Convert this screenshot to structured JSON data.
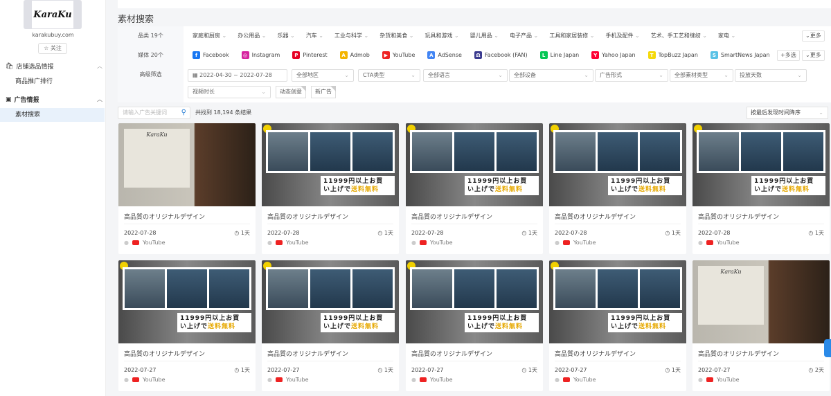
{
  "sidebar": {
    "logo_text": "KaraKu",
    "domain": "karakubuy.com",
    "follow": "☆ 关注",
    "sections": [
      {
        "label": "店铺选品情报",
        "items": [
          "商品推广排行"
        ]
      },
      {
        "label": "广告情报",
        "items": [
          "素材搜索"
        ]
      }
    ]
  },
  "page_title": "素材搜索",
  "filters": {
    "category_label": "品类 19个",
    "categories": [
      "家庭和厨房",
      "办公用品",
      "乐器",
      "汽车",
      "工业与科学",
      "杂货和美食",
      "玩具和游戏",
      "婴儿用品",
      "电子产品",
      "工具和家居装修",
      "手机及配件",
      "艺术、手工艺和缝纫",
      "家电"
    ],
    "more": "⌄更多",
    "media_label": "媒体 20个",
    "media": [
      {
        "name": "Facebook",
        "color": "#1877f2",
        "g": "f"
      },
      {
        "name": "Instagram",
        "color": "#d6249f",
        "g": "◎"
      },
      {
        "name": "Pinterest",
        "color": "#e60023",
        "g": "P"
      },
      {
        "name": "Admob",
        "color": "#f4b400",
        "g": "A"
      },
      {
        "name": "YouTube",
        "color": "#e22",
        "g": "▶"
      },
      {
        "name": "AdSense",
        "color": "#4285f4",
        "g": "A"
      },
      {
        "name": "Facebook (FAN)",
        "color": "#3b3b8f",
        "g": "Ω"
      },
      {
        "name": "Line Japan",
        "color": "#06c755",
        "g": "L"
      },
      {
        "name": "Yahoo Japan",
        "color": "#ff0033",
        "g": "Y"
      },
      {
        "name": "TopBuzz Japan",
        "color": "#f5d90a",
        "g": "T"
      },
      {
        "name": "SmartNews Japan",
        "color": "#59c2e6",
        "g": "S"
      }
    ],
    "multi": "+多选",
    "advanced_label": "高级筛选",
    "date_range": "2022-04-30 ~ 2022-07-28",
    "selects": [
      "全部地区",
      "CTA类型",
      "全部语言",
      "全部设备",
      "广告形式",
      "全部素材类型",
      "投放天数",
      "视频时长"
    ],
    "tags": [
      "动态创意",
      "新广告"
    ]
  },
  "search": {
    "placeholder": "请输入广告关键词"
  },
  "result_count": "共找到 18,194 条结果",
  "sort": "按最后发现时间降序",
  "banner": {
    "line1": "11999円以上お買",
    "line2": "い上げで",
    "free": "送料無料"
  },
  "cards": [
    {
      "title": "高品質のオリジナルデザイン",
      "date": "2022-07-28",
      "days": "1天",
      "platform": "YouTube",
      "style": "a"
    },
    {
      "title": "高品質のオリジナルデザイン",
      "date": "2022-07-28",
      "days": "1天",
      "platform": "YouTube",
      "style": "b"
    },
    {
      "title": "高品質のオリジナルデザイン",
      "date": "2022-07-28",
      "days": "1天",
      "platform": "YouTube",
      "style": "b"
    },
    {
      "title": "高品質のオリジナルデザイン",
      "date": "2022-07-28",
      "days": "1天",
      "platform": "YouTube",
      "style": "b"
    },
    {
      "title": "高品質のオリジナルデザイン",
      "date": "2022-07-28",
      "days": "1天",
      "platform": "YouTube",
      "style": "b"
    },
    {
      "title": "高品質のオリジナルデザイン",
      "date": "2022-07-27",
      "days": "1天",
      "platform": "YouTube",
      "style": "b"
    },
    {
      "title": "高品質のオリジナルデザイン",
      "date": "2022-07-27",
      "days": "1天",
      "platform": "YouTube",
      "style": "b"
    },
    {
      "title": "高品質のオリジナルデザイン",
      "date": "2022-07-27",
      "days": "1天",
      "platform": "YouTube",
      "style": "b"
    },
    {
      "title": "高品質のオリジナルデザイン",
      "date": "2022-07-27",
      "days": "1天",
      "platform": "YouTube",
      "style": "b"
    },
    {
      "title": "高品質のオリジナルデザイン",
      "date": "2022-07-27",
      "days": "2天",
      "platform": "YouTube",
      "style": "a"
    }
  ]
}
